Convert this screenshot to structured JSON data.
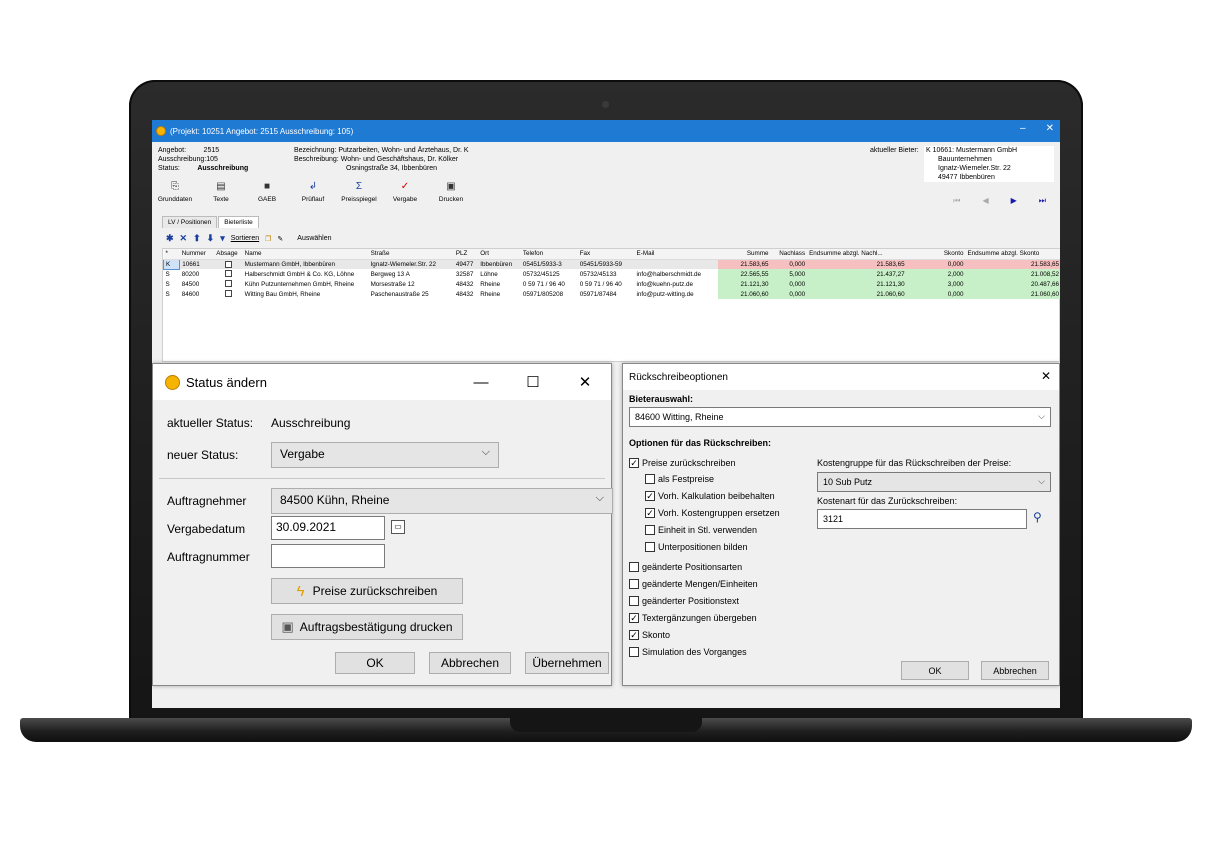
{
  "window": {
    "title": "(Projekt: 10251 Angebot: 2515  Ausschreibung: 105)",
    "min": "–",
    "close": "✕"
  },
  "info": {
    "angebot_label": "Angebot:",
    "angebot_value": "2515",
    "ausschreibung_label": "Ausschreibung:",
    "ausschreibung_value": "105",
    "status_label": "Status:",
    "status_value": "Ausschreibung",
    "bezeichnung_label": "Bezeichnung:",
    "bezeichnung_value": "Putzarbeiten, Wohn- und Ärztehaus, Dr. K",
    "beschreibung_label": "Beschreibung:",
    "beschreibung_value": "Wohn- und Geschäftshaus, Dr. Kölker",
    "address_line": "Osningstraße 34, Ibbenbüren",
    "bieter_label": "aktueller Bieter:",
    "bieter_lines": [
      "K 10661: Mustermann GmbH",
      "Bauunternehmen",
      "Ignatz-Wiemeler.Str. 22",
      "49477 Ibbenbüren"
    ]
  },
  "toolbar": [
    "Grunddaten",
    "Texte",
    "GAEB",
    "Prüflauf",
    "Preisspiegel",
    "Vergabe",
    "Drucken"
  ],
  "tabs": [
    "LV / Positionen",
    "Bieterliste"
  ],
  "subtoolbar": {
    "sortieren": "Sortieren",
    "auswaehlen": "Auswählen"
  },
  "grid": {
    "headers": [
      "*",
      "Nummer",
      "Absage",
      "Name",
      "Straße",
      "PLZ",
      "Ort",
      "Telefon",
      "Fax",
      "E-Mail",
      "Summe",
      "Nachlass",
      "Endsumme abzgl. Nachl...",
      "Skonto",
      "Endsumme abzgl. Skonto"
    ],
    "rows": [
      {
        "flag": "K",
        "nummer": "10661",
        "name": "Mustermann GmbH, Ibbenbüren",
        "strasse": "Ignatz-Wiemeler.Str. 22",
        "plz": "49477",
        "ort": "Ibbenbüren",
        "telefon": "05451/5933-3",
        "fax": "05451/5933-59",
        "email": "",
        "summe": "21.583,65",
        "nachlass": "0,000",
        "endsumme": "21.583,65",
        "skonto": "0,000",
        "endskonto": "21.583,65",
        "color": "red"
      },
      {
        "flag": "S",
        "nummer": "80200",
        "name": "Halberschmidt GmbH & Co. KG, Löhne",
        "strasse": "Bergweg 13 A",
        "plz": "32587",
        "ort": "Löhne",
        "telefon": "05732/45125",
        "fax": "05732/45133",
        "email": "info@halberschmidt.de",
        "summe": "22.565,55",
        "nachlass": "5,000",
        "endsumme": "21.437,27",
        "skonto": "2,000",
        "endskonto": "21.008,52",
        "color": "green"
      },
      {
        "flag": "S",
        "nummer": "84500",
        "name": "Kühn Putzunternehmen GmbH, Rheine",
        "strasse": "Morsestraße 12",
        "plz": "48432",
        "ort": "Rheine",
        "telefon": "0 59 71 / 96 40",
        "fax": "0 59 71 / 96 40",
        "email": "info@kuehn-putz.de",
        "summe": "21.121,30",
        "nachlass": "0,000",
        "endsumme": "21.121,30",
        "skonto": "3,000",
        "endskonto": "20.487,66",
        "color": "green"
      },
      {
        "flag": "S",
        "nummer": "84600",
        "name": "Witting Bau GmbH, Rheine",
        "strasse": "Paschenaustraße 25",
        "plz": "48432",
        "ort": "Rheine",
        "telefon": "05971/805208",
        "fax": "05971/87484",
        "email": "info@putz-witting.de",
        "summe": "21.060,60",
        "nachlass": "0,000",
        "endsumme": "21.060,60",
        "skonto": "0,000",
        "endskonto": "21.060,60",
        "color": "green"
      }
    ]
  },
  "status_dialog": {
    "title": "Status ändern",
    "aktueller_label": "aktueller Status:",
    "aktueller_value": "Ausschreibung",
    "neuer_label": "neuer Status:",
    "neuer_value": "Vergabe",
    "auftragnehmer_label": "Auftragnehmer",
    "auftragnehmer_value": "84500 Kühn, Rheine",
    "vergabedatum_label": "Vergabedatum",
    "vergabedatum_value": "30.09.2021",
    "auftragnummer_label": "Auftragnummer",
    "auftragnummer_value": "",
    "btn_preise": "Preise zurückschreiben",
    "btn_druck": "Auftragsbestätigung drucken",
    "btn_ok": "OK",
    "btn_abbrechen": "Abbrechen",
    "btn_uebernehmen": "Übernehmen"
  },
  "options_dialog": {
    "title": "Rückschreibeoptionen",
    "bieterauswahl_label": "Bieterauswahl:",
    "bieterauswahl_value": "84600 Witting, Rheine",
    "optionen_label": "Optionen für das Rückschreiben:",
    "checks": [
      {
        "label": "Preise zurückschreiben",
        "checked": true
      },
      {
        "label": "als Festpreise",
        "checked": false
      },
      {
        "label": "Vorh. Kalkulation beibehalten",
        "checked": true
      },
      {
        "label": "Vorh. Kostengruppen ersetzen",
        "checked": true
      },
      {
        "label": "Einheit in Stl. verwenden",
        "checked": false
      },
      {
        "label": "Unterpositionen bilden",
        "checked": false
      },
      {
        "label": "geänderte Positionsarten",
        "checked": false
      },
      {
        "label": "geänderte Mengen/Einheiten",
        "checked": false
      },
      {
        "label": "geänderter Positionstext",
        "checked": false
      },
      {
        "label": "Textergänzungen übergeben",
        "checked": true
      },
      {
        "label": "Skonto",
        "checked": true
      },
      {
        "label": "Simulation des Vorganges",
        "checked": false
      }
    ],
    "kostengruppe_label": "Kostengruppe für das Rückschreiben der Preise:",
    "kostengruppe_value": "10 Sub Putz",
    "kostenart_label": "Kostenart für das Zurückschreiben:",
    "kostenart_value": "3121",
    "btn_ok": "OK",
    "btn_abbrechen": "Abbrechen"
  }
}
